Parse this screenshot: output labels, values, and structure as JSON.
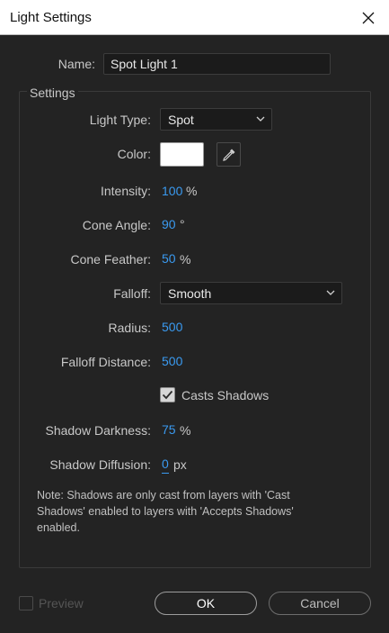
{
  "window": {
    "title": "Light Settings"
  },
  "name": {
    "label": "Name:",
    "value": "Spot Light 1"
  },
  "settings": {
    "group_title": "Settings",
    "light_type": {
      "label": "Light Type:",
      "value": "Spot"
    },
    "color": {
      "label": "Color:",
      "swatch": "#ffffff"
    },
    "intensity": {
      "label": "Intensity:",
      "value": "100",
      "unit": "%"
    },
    "cone_angle": {
      "label": "Cone Angle:",
      "value": "90",
      "unit": "°"
    },
    "cone_feather": {
      "label": "Cone Feather:",
      "value": "50",
      "unit": "%"
    },
    "falloff": {
      "label": "Falloff:",
      "value": "Smooth"
    },
    "radius": {
      "label": "Radius:",
      "value": "500"
    },
    "falloff_distance": {
      "label": "Falloff Distance:",
      "value": "500"
    },
    "casts_shadows": {
      "label": "Casts Shadows",
      "checked": true
    },
    "shadow_darkness": {
      "label": "Shadow Darkness:",
      "value": "75",
      "unit": "%"
    },
    "shadow_diffusion": {
      "label": "Shadow Diffusion:",
      "value": "0",
      "unit": "px"
    },
    "note": "Note: Shadows are only cast from layers with 'Cast Shadows' enabled to layers with 'Accepts Shadows' enabled."
  },
  "footer": {
    "preview_label": "Preview",
    "ok_label": "OK",
    "cancel_label": "Cancel"
  },
  "colors": {
    "background": "#232323",
    "value_blue": "#3a9af0",
    "titlebar": "#ffffff"
  },
  "icons": {
    "close": "close-icon",
    "eyedropper": "eyedropper-icon",
    "chevron": "chevron-down-icon",
    "check": "checkmark-icon"
  }
}
